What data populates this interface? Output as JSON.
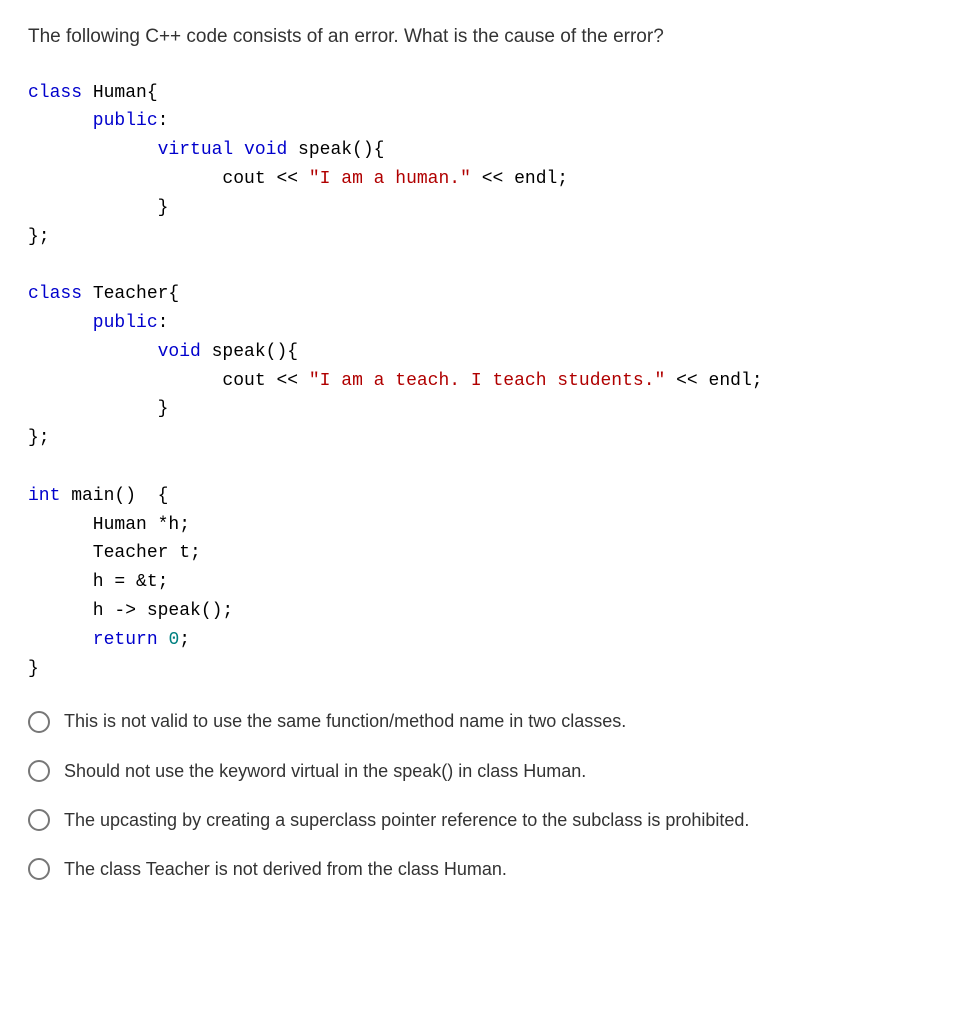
{
  "question": "The following C++ code consists of an error. What is the cause of the error?",
  "code": {
    "l1a": "class",
    "l1b": " Human{",
    "l2a": "      public",
    "l2b": ":",
    "l3a": "            virtual void",
    "l3b": " speak(){",
    "l4a": "                  cout << ",
    "l4b": "\"I am a human.\"",
    "l4c": " << endl;",
    "l5": "            }",
    "l6": "};",
    "l7a": "class",
    "l7b": " Teacher{",
    "l8a": "      public",
    "l8b": ":",
    "l9a": "            void",
    "l9b": " speak(){",
    "l10a": "                  cout << ",
    "l10b": "\"I am a teach. I teach students.\"",
    "l10c": " << endl;",
    "l11": "            }",
    "l12": "};",
    "l13a": "int",
    "l13b": " main()  {",
    "l14": "      Human *h;",
    "l15": "      Teacher t;",
    "l16": "      h = &t;",
    "l17": "      h -> speak();",
    "l18a": "      return ",
    "l18b": "0",
    "l18c": ";",
    "l19": "}"
  },
  "options": [
    "This is not valid to use the same function/method name in two classes.",
    "Should not use the keyword virtual in the speak() in class Human.",
    "The upcasting by creating a superclass pointer reference to the subclass is prohibited.",
    "The class Teacher is not derived from the class Human."
  ]
}
